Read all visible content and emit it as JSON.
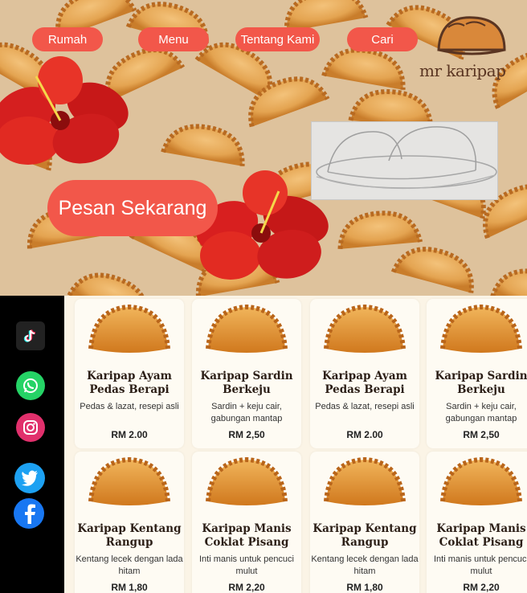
{
  "nav": {
    "items": [
      {
        "label": "Rumah"
      },
      {
        "label": "Menu"
      },
      {
        "label": "Tentang Kami"
      },
      {
        "label": "Cari"
      }
    ]
  },
  "brand": {
    "name": "mr karipap"
  },
  "hero": {
    "cta": "Pesan Sekarang"
  },
  "social": [
    "tiktok-icon",
    "whatsapp-icon",
    "instagram-icon",
    "twitter-icon",
    "facebook-icon"
  ],
  "products": [
    {
      "name": "Karipap Ayam Pedas Berapi",
      "desc": "Pedas & lazat, resepi asli",
      "price": "RM 2.00"
    },
    {
      "name": "Karipap Sardin Berkeju",
      "desc": "Sardin + keju cair, gabungan mantap",
      "price": "RM 2,50"
    },
    {
      "name": "Karipap Ayam Pedas Berapi",
      "desc": "Pedas & lazat, resepi asli",
      "price": "RM 2.00"
    },
    {
      "name": "Karipap Sardin Berkeju",
      "desc": "Sardin + keju cair, gabungan mantap",
      "price": "RM 2,50"
    },
    {
      "name": "Karipap Kentang Rangup",
      "desc": "Kentang lecek dengan lada hitam",
      "price": "RM 1,80"
    },
    {
      "name": "Karipap Manis Coklat Pisang",
      "desc": "Inti manis untuk pencuci mulut",
      "price": "RM 2,20"
    },
    {
      "name": "Karipap Kentang Rangup",
      "desc": "Kentang lecek dengan lada hitam",
      "price": "RM 1,80"
    },
    {
      "name": "Karipap Manis Coklat Pisang",
      "desc": "Inti manis untuk pencuci mulut",
      "price": "RM 2,20"
    }
  ],
  "colors": {
    "accent": "#f2574a",
    "sidebar": "#000000",
    "crust": "#d98a2e"
  }
}
